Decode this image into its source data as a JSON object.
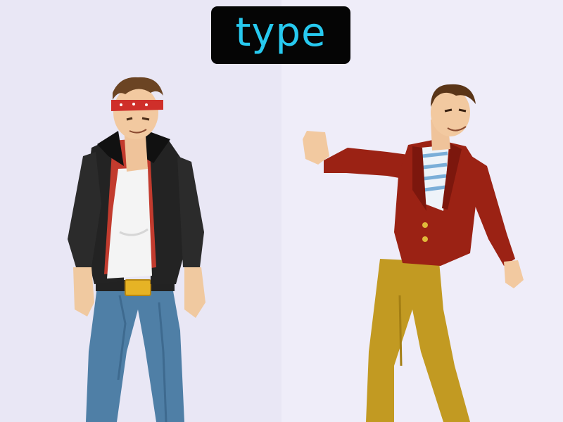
{
  "word_card": {
    "label": "type",
    "text_color": "#27c9ef",
    "background_color": "#050505"
  },
  "illustrations": [
    {
      "name": "rocker-man-figure",
      "icon": "person-illustration"
    },
    {
      "name": "dancing-man-figure",
      "icon": "person-illustration"
    }
  ],
  "colors": {
    "background_left": "#e9e7f5",
    "background_right": "#efedf9",
    "left_jacket": "#232323",
    "left_jeans": "#4f7fa6",
    "right_blazer": "#9b2214",
    "right_pants": "#c29a22"
  }
}
